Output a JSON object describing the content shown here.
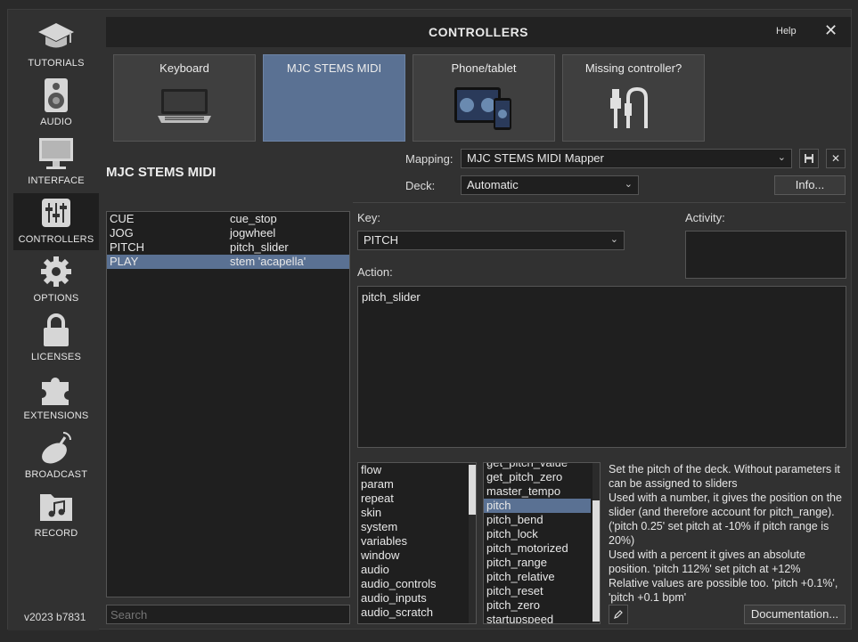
{
  "window": {
    "title": "CONTROLLERS",
    "help": "Help",
    "close": "✕"
  },
  "sidebar": {
    "items": [
      {
        "label": "TUTORIALS",
        "icon": "graduation-cap-icon"
      },
      {
        "label": "AUDIO",
        "icon": "speaker-icon"
      },
      {
        "label": "INTERFACE",
        "icon": "monitor-icon"
      },
      {
        "label": "CONTROLLERS",
        "icon": "sliders-icon"
      },
      {
        "label": "OPTIONS",
        "icon": "gear-icon"
      },
      {
        "label": "LICENSES",
        "icon": "lock-icon"
      },
      {
        "label": "EXTENSIONS",
        "icon": "puzzle-icon"
      },
      {
        "label": "BROADCAST",
        "icon": "satellite-dish-icon"
      },
      {
        "label": "RECORD",
        "icon": "music-folder-icon"
      }
    ],
    "active": "CONTROLLERS",
    "version": "v2023 b7831"
  },
  "tabs": [
    {
      "label": "Keyboard",
      "icon": "laptop-keyboard-icon"
    },
    {
      "label": "MJC STEMS MIDI",
      "icon": ""
    },
    {
      "label": "Phone/tablet",
      "icon": "tablet-phone-icon"
    },
    {
      "label": "Missing controller?",
      "icon": "usb-cable-icon"
    }
  ],
  "device_title": "MJC STEMS MIDI",
  "mapping": {
    "label": "Mapping:",
    "value": "MJC STEMS MIDI Mapper",
    "save_icon": "save-icon",
    "delete_icon": "close-icon"
  },
  "deck": {
    "label": "Deck:",
    "value": "Automatic"
  },
  "info_button": "Info...",
  "mappings": [
    {
      "key": "CUE",
      "action": "cue_stop"
    },
    {
      "key": "JOG",
      "action": "jogwheel"
    },
    {
      "key": "PITCH",
      "action": "pitch_slider"
    },
    {
      "key": "PLAY",
      "action": "stem 'acapella'"
    }
  ],
  "selected_mapping": "PLAY",
  "search_placeholder": "Search",
  "key": {
    "label": "Key:",
    "value": "PITCH"
  },
  "activity_label": "Activity:",
  "action": {
    "label": "Action:",
    "value": "pitch_slider"
  },
  "categories": [
    "flow",
    "param",
    "repeat",
    "skin",
    "system",
    "variables",
    "window",
    "audio",
    "audio_controls",
    "audio_inputs",
    "audio_scratch"
  ],
  "verbs": [
    "get_pitch_value",
    "get_pitch_zero",
    "master_tempo",
    "pitch",
    "pitch_bend",
    "pitch_lock",
    "pitch_motorized",
    "pitch_range",
    "pitch_relative",
    "pitch_reset",
    "pitch_zero",
    "startupspeed"
  ],
  "selected_verb": "pitch",
  "description": [
    "Set the pitch of the deck. Without parameters it can be assigned to sliders",
    "Used with a number, it gives the position on the slider (and therefore account for pitch_range). ('pitch 0.25' set pitch at -10% if pitch range is 20%)",
    "Used with a percent it gives an absolute position.  'pitch 112%' set pitch at +12%",
    "Relative values are possible too. 'pitch +0.1%', 'pitch +0.1 bpm'"
  ],
  "edit_icon": "pencil-icon",
  "documentation_button": "Documentation...",
  "colors": {
    "accent": "#5a7193",
    "panel": "#313131",
    "field": "#1f1f1f"
  }
}
